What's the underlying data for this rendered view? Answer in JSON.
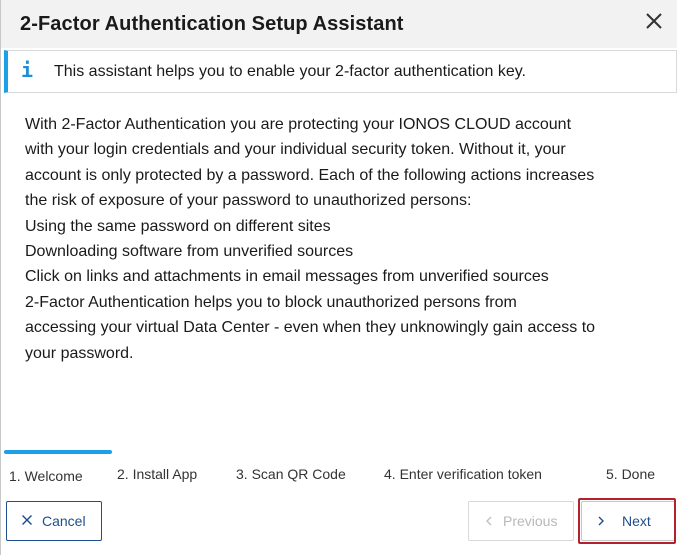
{
  "dialog": {
    "title": "2-Factor Authentication Setup Assistant",
    "close_icon": "close-icon"
  },
  "info": {
    "icon": "info-icon",
    "text": "This assistant helps you to enable your 2-factor authentication key."
  },
  "body": {
    "lines": [
      "With 2-Factor Authentication you are protecting your IONOS CLOUD account",
      "with your login credentials and your individual security token. Without it, your",
      "account is only protected by a password. Each of the following actions increases",
      "the risk of exposure of your password to unauthorized persons:",
      "Using the same password on different sites",
      "Downloading software from unverified sources",
      "Click on links and attachments in email messages from unverified sources",
      "2-Factor Authentication helps you to block unauthorized persons from",
      "accessing your virtual Data Center - even when they unknowingly gain access to",
      "your password."
    ]
  },
  "steps": {
    "active_index": 0,
    "items": [
      "1. Welcome",
      "2. Install App",
      "3. Scan QR Code",
      "4. Enter verification token",
      "5. Done"
    ]
  },
  "buttons": {
    "cancel_label": "Cancel",
    "previous_label": "Previous",
    "next_label": "Next",
    "previous_disabled": true
  },
  "colors": {
    "accent": "#1ea0e8",
    "primary_text": "#1f4e8c",
    "highlight_border": "#b0222e",
    "header_bg": "#f2f2f2"
  }
}
